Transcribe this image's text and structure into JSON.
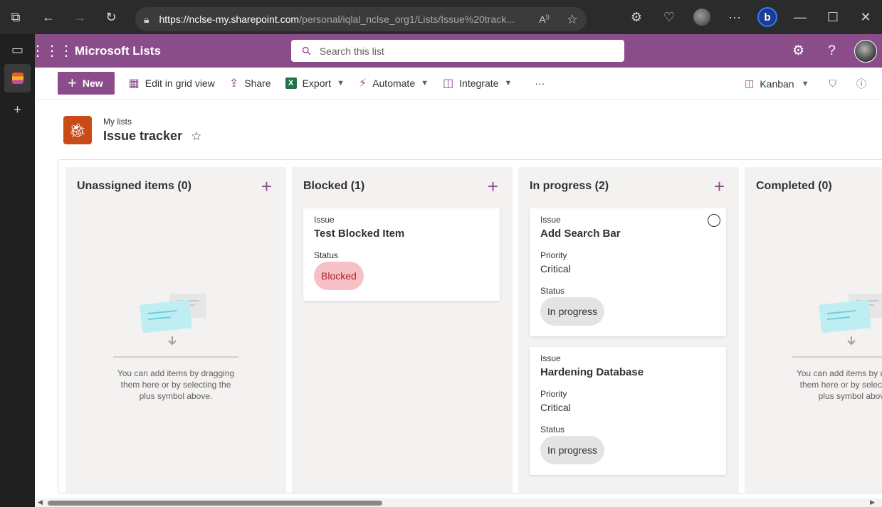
{
  "browser": {
    "url_host": "https://nclse-my.sharepoint.com",
    "url_rest": "/personal/iqlal_nclse_org1/Lists/Issue%20track...",
    "bing_label": "b"
  },
  "suitebar": {
    "app_name": "Microsoft Lists",
    "search_placeholder": "Search this list"
  },
  "commandbar": {
    "new_label": "New",
    "edit_grid_label": "Edit in grid view",
    "share_label": "Share",
    "export_label": "Export",
    "automate_label": "Automate",
    "integrate_label": "Integrate",
    "more_label": "···",
    "view_label": "Kanban"
  },
  "list": {
    "breadcrumb": "My lists",
    "title": "Issue tracker"
  },
  "board": {
    "columns": [
      {
        "title": "Unassigned items (0)",
        "empty_text": "You can add items by dragging them here or by selecting the plus symbol above."
      },
      {
        "title": "Blocked (1)"
      },
      {
        "title": "In progress (2)"
      },
      {
        "title": "Completed (0)",
        "empty_text": "You can add items by dragging them here or by selecting the plus symbol above."
      }
    ],
    "cards": [
      {
        "issue_label": "Issue",
        "issue": "Test Blocked Item",
        "status_label": "Status",
        "status": "Blocked"
      },
      {
        "issue_label": "Issue",
        "issue": "Add Search Bar",
        "priority_label": "Priority",
        "priority": "Critical",
        "status_label": "Status",
        "status": "In progress"
      },
      {
        "issue_label": "Issue",
        "issue": "Hardening Database",
        "priority_label": "Priority",
        "priority": "Critical",
        "status_label": "Status",
        "status": "In progress"
      }
    ]
  },
  "colors": {
    "brand": "#8a4d8a",
    "list_icon": "#c84b1a",
    "blocked_bg": "#f7c0c4",
    "progress_bg": "#e4e4e4"
  }
}
